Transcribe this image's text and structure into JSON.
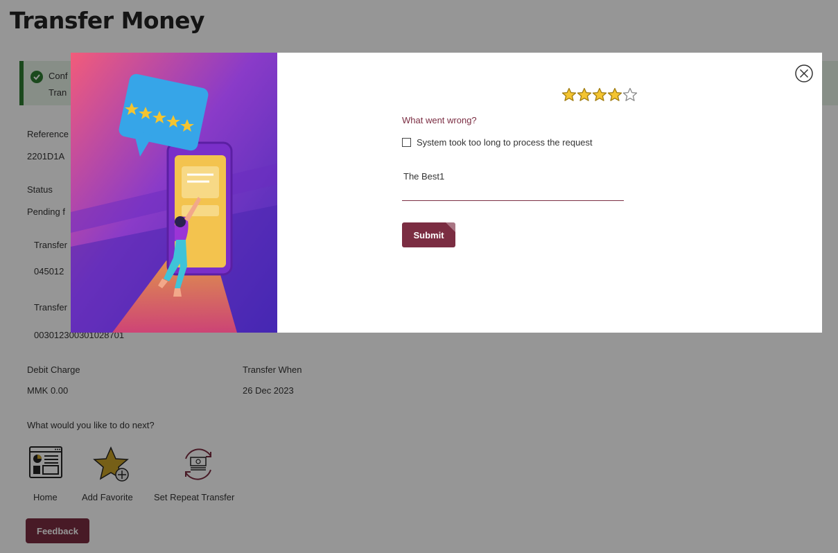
{
  "page": {
    "title": "Transfer Money",
    "confirmation": {
      "line1": "Conf",
      "line2": "Tran"
    },
    "fields": {
      "reference_label": "Reference",
      "reference_value": "2201D1A",
      "status_label": "Status",
      "status_value": "Pending f",
      "transfer_from_label": "Transfer",
      "transfer_from_value": "045012",
      "transfer_to_label": "Transfer",
      "transfer_to_value": "003012300301028701",
      "debit_charge_label": "Debit Charge",
      "debit_charge_value": "MMK 0.00",
      "transfer_when_label": "Transfer When",
      "transfer_when_value": "26 Dec 2023"
    },
    "next_prompt": "What would you like to do next?",
    "actions": [
      {
        "label": "Home",
        "icon": "home-dashboard-icon"
      },
      {
        "label": "Add Favorite",
        "icon": "star-add-icon"
      },
      {
        "label": "Set Repeat Transfer",
        "icon": "repeat-transfer-icon"
      }
    ],
    "feedback_label": "Feedback"
  },
  "modal": {
    "rating": {
      "value": 4,
      "max": 5
    },
    "question": "What went wrong?",
    "options": [
      {
        "label": "System took too long to process the request",
        "checked": false
      }
    ],
    "comment_value": "The Best1",
    "submit_label": "Submit",
    "icons": {
      "close": "close-circle-icon",
      "illustration": "rating-illustration"
    }
  },
  "colors": {
    "brand": "#7b2d42",
    "success": "#2e7d32",
    "star": "#f4c430",
    "overlay": "rgba(0,0,0,0.41)"
  }
}
